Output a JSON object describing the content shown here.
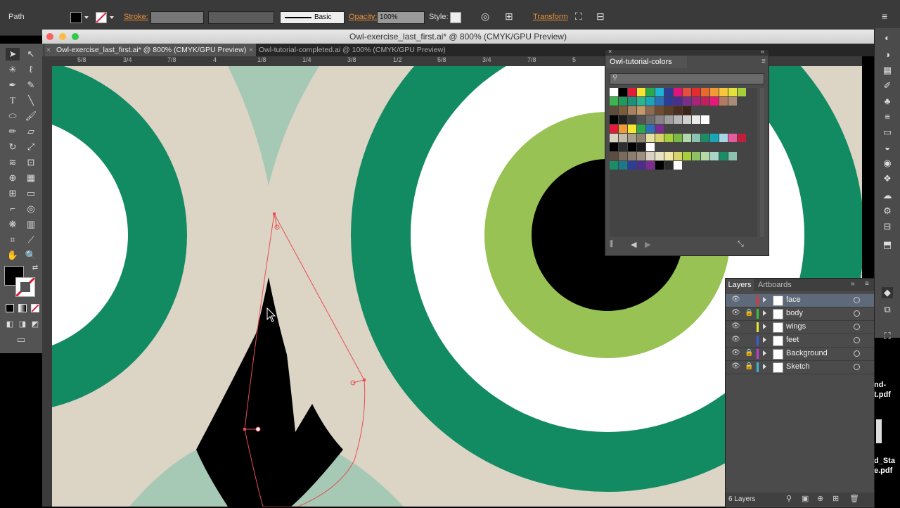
{
  "control_bar": {
    "selection_type": "Path",
    "stroke_label": "Stroke:",
    "stroke_style": "Basic",
    "opacity_label": "Opacity:",
    "opacity_value": "100%",
    "style_label": "Style:",
    "transform_label": "Transform"
  },
  "window": {
    "title": "Owl-exercise_last_first.ai* @ 800% (CMYK/GPU Preview)"
  },
  "tabs": [
    {
      "label": "Owl-exercise_last_first.ai* @ 800% (CMYK/GPU Preview)",
      "active": true
    },
    {
      "label": "Owl-tutorial-completed.ai @ 100% (CMYK/GPU Preview)",
      "active": false
    }
  ],
  "ruler": {
    "h_labels": [
      "5/8",
      "3/4",
      "7/8",
      "4",
      "1/8",
      "1/4",
      "3/8",
      "1/2",
      "5/8",
      "3/4",
      "7/8",
      "5"
    ]
  },
  "swatch_panel": {
    "title": "Owl-tutorial-colors",
    "rows": [
      [
        "#ffffff",
        "#000000",
        "#e01b3c",
        "#f7e531",
        "#2aa84a",
        "#1fb3d6",
        "#2b3d96",
        "#e1147c",
        "#e84d3d",
        "#e12d2d",
        "#e86a2d",
        "#f29a36",
        "#f7c63a",
        "#e6e13a",
        "#a6cf3b"
      ],
      [
        "#3fb34f",
        "#1f9a59",
        "#1e8f7a",
        "#2cb38f",
        "#1aa6b8",
        "#2b71b8",
        "#2b3d96",
        "#4b2d8c",
        "#7a2d8c",
        "#a6247a",
        "#c21f5e",
        "#e6197a",
        "#b27a5e",
        "#a88c7a"
      ],
      [
        "#5e4d3c",
        "#7a5e3c",
        "#a8825e",
        "#c29a6a",
        "#8c6a4d",
        "#6e4d33",
        "#5c3d26",
        "#4a2f1f",
        "#3b2418"
      ],
      [
        "#000000",
        "#1f1f1f",
        "#383838",
        "#525252",
        "#6b6b6b",
        "#858585",
        "#9e9e9e",
        "#b8b8b8",
        "#d1d1d1",
        "#ebebeb",
        "#ffffff"
      ],
      [
        "#e01b3c",
        "#f29a36",
        "#f7e531",
        "#2aa84a",
        "#2b71b8",
        "#7a2d8c"
      ],
      [
        "#d9d1c2",
        "#c4baa8",
        "#a89e8c",
        "#8c8272",
        "#e6e1a0",
        "#d7d36a",
        "#a6cf3b",
        "#7ab84a",
        "#b4d9a8",
        "#8cc2b0",
        "#1a8c66",
        "#1aa6b8",
        "#a8d5e6",
        "#e65a9e",
        "#c21f3c"
      ],
      [
        "#000000",
        "#2e2e2e",
        "#000000",
        "#1a1a1a",
        "#ffffff"
      ],
      [
        "#5c4d40",
        "#7a6b5c",
        "#8c7d6e",
        "#9e8f80",
        "#d9d1c2",
        "#e6e1c2",
        "#f0e6a8",
        "#d7d36a",
        "#a6cf3b",
        "#8cc263",
        "#b4d9a8",
        "#a8d5c8",
        "#1a8c66",
        "#8cc2b0"
      ],
      [
        "#1a8c66",
        "#1a7a8c",
        "#2b3d96",
        "#4a2d8c",
        "#7a2d8c",
        "#000000",
        "#2b2b2b",
        "#ffffff"
      ]
    ]
  },
  "layers_panel": {
    "tabs": [
      "Layers",
      "Artboards"
    ],
    "layers": [
      {
        "name": "face",
        "color": "#e0343b",
        "locked": false,
        "selected": true
      },
      {
        "name": "body",
        "color": "#3cc13c",
        "locked": true,
        "selected": false
      },
      {
        "name": "wings",
        "color": "#ece43a",
        "locked": false,
        "selected": false
      },
      {
        "name": "feet",
        "color": "#3b5cd6",
        "locked": false,
        "selected": false
      },
      {
        "name": "Background",
        "color": "#c23cd6",
        "locked": true,
        "selected": false
      },
      {
        "name": "Sketch",
        "color": "#3cb4d6",
        "locked": true,
        "selected": false
      }
    ],
    "footer_count": "6 Layers"
  },
  "desktop": {
    "file1": "nd-\nt.pdf",
    "file2": "d_Sta\ne.pdf"
  },
  "colors": {
    "teal": "#128a62",
    "cream": "#dcd4c4",
    "mint": "#a6c9b5",
    "lime": "#98c253",
    "path_red": "#e84d55"
  }
}
